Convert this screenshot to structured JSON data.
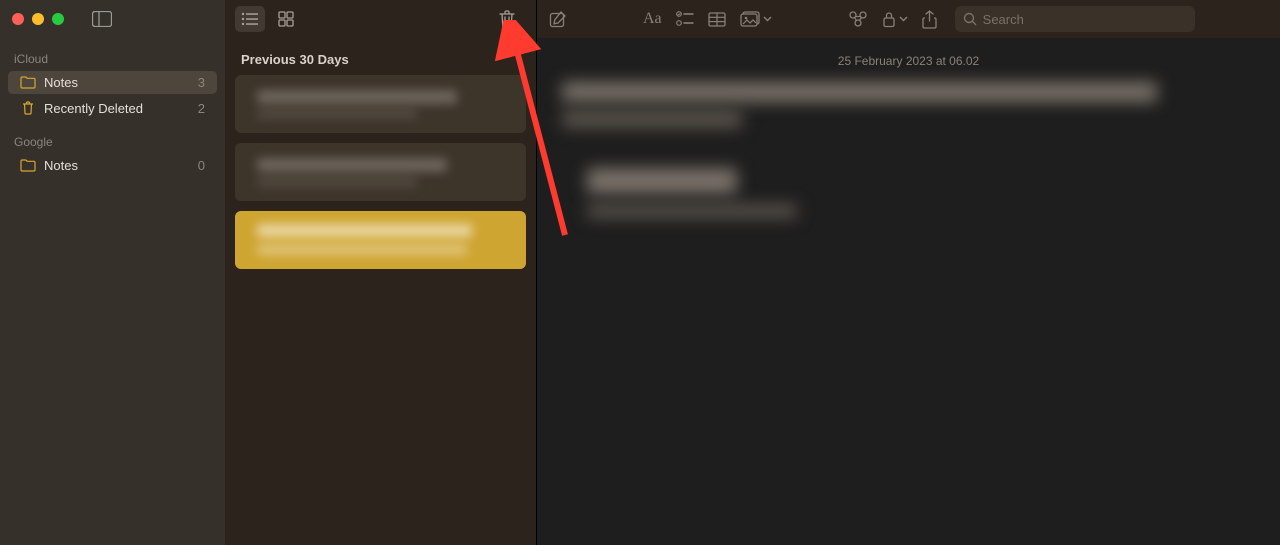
{
  "sidebar": {
    "sections": [
      {
        "title": "iCloud",
        "items": [
          {
            "icon": "folder",
            "label": "Notes",
            "count": "3",
            "selected": true
          },
          {
            "icon": "trash",
            "label": "Recently Deleted",
            "count": "2",
            "selected": false
          }
        ]
      },
      {
        "title": "Google",
        "items": [
          {
            "icon": "folder",
            "label": "Notes",
            "count": "0",
            "selected": false
          }
        ]
      }
    ]
  },
  "list": {
    "section_header": "Previous 30 Days"
  },
  "editor": {
    "date": "25 February 2023 at 06.02",
    "search_placeholder": "Search"
  }
}
